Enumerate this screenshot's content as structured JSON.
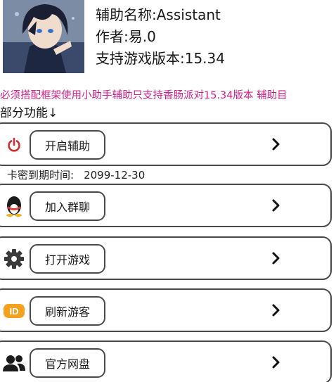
{
  "info": {
    "name": "辅助名称:Assistant",
    "author": "作者:易.0",
    "version": "支持游戏版本:15.34"
  },
  "notice": "必须搭配框架使用小助手辅助只支持香肠派对15.34版本 辅助目",
  "section_title": "部分功能↓",
  "expiry": {
    "label": "卡密到期时间:",
    "value": "2099-12-30"
  },
  "rows": [
    {
      "label": "开启辅助",
      "icon": "power-icon"
    },
    {
      "label": "加入群聊",
      "icon": "qq-penguin-icon"
    },
    {
      "label": "打开游戏",
      "icon": "gear-icon"
    },
    {
      "label": "刷新游客",
      "icon": "id-badge-icon"
    },
    {
      "label": "官方网盘",
      "icon": "users-icon"
    }
  ],
  "colors": {
    "notice": "#d0208a",
    "power": "#d32f2f",
    "id_badge": "#f4a21e",
    "border": "#4a4a4a"
  }
}
